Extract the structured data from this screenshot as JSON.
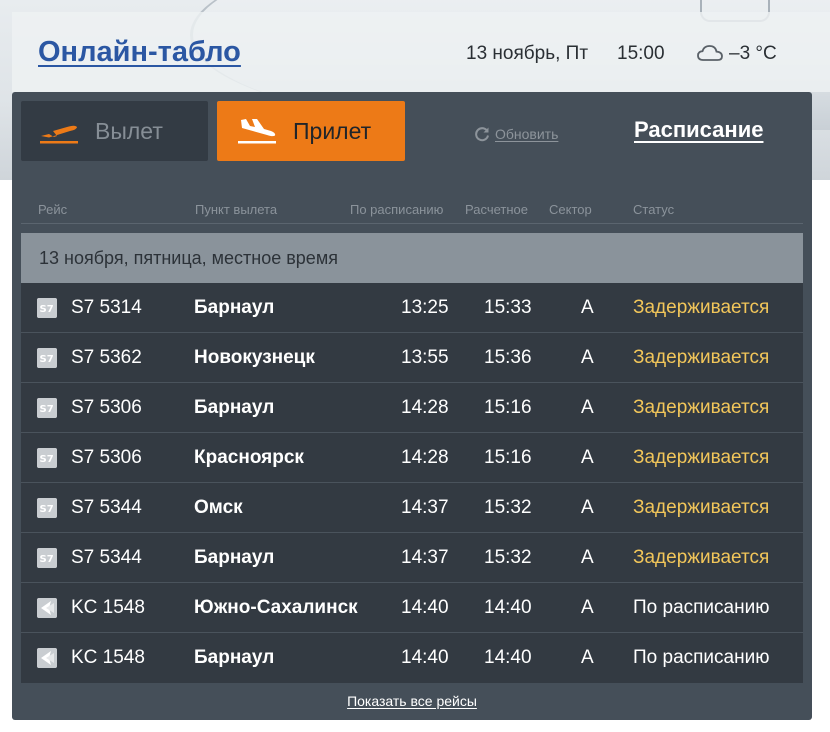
{
  "header": {
    "title": "Онлайн-табло",
    "date": "13 ноябрь, Пт",
    "time": "15:00",
    "weather_icon": "cloud-icon",
    "temperature": "–3 °C"
  },
  "tabs": {
    "departure": {
      "label": "Вылет",
      "icon": "plane-takeoff-icon",
      "active": false
    },
    "arrival": {
      "label": "Прилет",
      "icon": "plane-landing-icon",
      "active": true
    }
  },
  "toolbar": {
    "refresh_label": "Обновить",
    "schedule_label": "Расписание"
  },
  "table": {
    "headers": {
      "flight": "Рейс",
      "origin": "Пункт вылета",
      "scheduled": "По расписанию",
      "estimated": "Расчетное",
      "sector": "Сектор",
      "status": "Статус"
    },
    "date_label": "13 ноября, пятница, местное время",
    "rows": [
      {
        "airline_logo": "s7-logo-icon",
        "flight": "S7 5314",
        "city": "Барнаул",
        "scheduled": "13:25",
        "estimated": "15:33",
        "sector": "A",
        "status": "Задерживается",
        "status_kind": "delayed"
      },
      {
        "airline_logo": "s7-logo-icon",
        "flight": "S7 5362",
        "city": "Новокузнецк",
        "scheduled": "13:55",
        "estimated": "15:36",
        "sector": "A",
        "status": "Задерживается",
        "status_kind": "delayed"
      },
      {
        "airline_logo": "s7-logo-icon",
        "flight": "S7 5306",
        "city": "Барнаул",
        "scheduled": "14:28",
        "estimated": "15:16",
        "sector": "A",
        "status": "Задерживается",
        "status_kind": "delayed"
      },
      {
        "airline_logo": "s7-logo-icon",
        "flight": "S7 5306",
        "city": "Красноярск",
        "scheduled": "14:28",
        "estimated": "15:16",
        "sector": "A",
        "status": "Задерживается",
        "status_kind": "delayed"
      },
      {
        "airline_logo": "s7-logo-icon",
        "flight": "S7 5344",
        "city": "Омск",
        "scheduled": "14:37",
        "estimated": "15:32",
        "sector": "A",
        "status": "Задерживается",
        "status_kind": "delayed"
      },
      {
        "airline_logo": "s7-logo-icon",
        "flight": "S7 5344",
        "city": "Барнаул",
        "scheduled": "14:37",
        "estimated": "15:32",
        "sector": "A",
        "status": "Задерживается",
        "status_kind": "delayed"
      },
      {
        "airline_logo": "kc-logo-icon",
        "flight": "KC 1548",
        "city": "Южно-Сахалинск",
        "scheduled": "14:40",
        "estimated": "14:40",
        "sector": "A",
        "status": "По расписанию",
        "status_kind": "ontime"
      },
      {
        "airline_logo": "kc-logo-icon",
        "flight": "KC 1548",
        "city": "Барнаул",
        "scheduled": "14:40",
        "estimated": "14:40",
        "sector": "A",
        "status": "По расписанию",
        "status_kind": "ontime"
      }
    ]
  },
  "footer": {
    "show_all_label": "Показать все рейсы"
  },
  "colors": {
    "accent": "#ed7a17",
    "title_link": "#2b57a3",
    "delayed_status": "#f2c65a",
    "board_bg": "#454f59",
    "row_bg": "#333a42"
  }
}
